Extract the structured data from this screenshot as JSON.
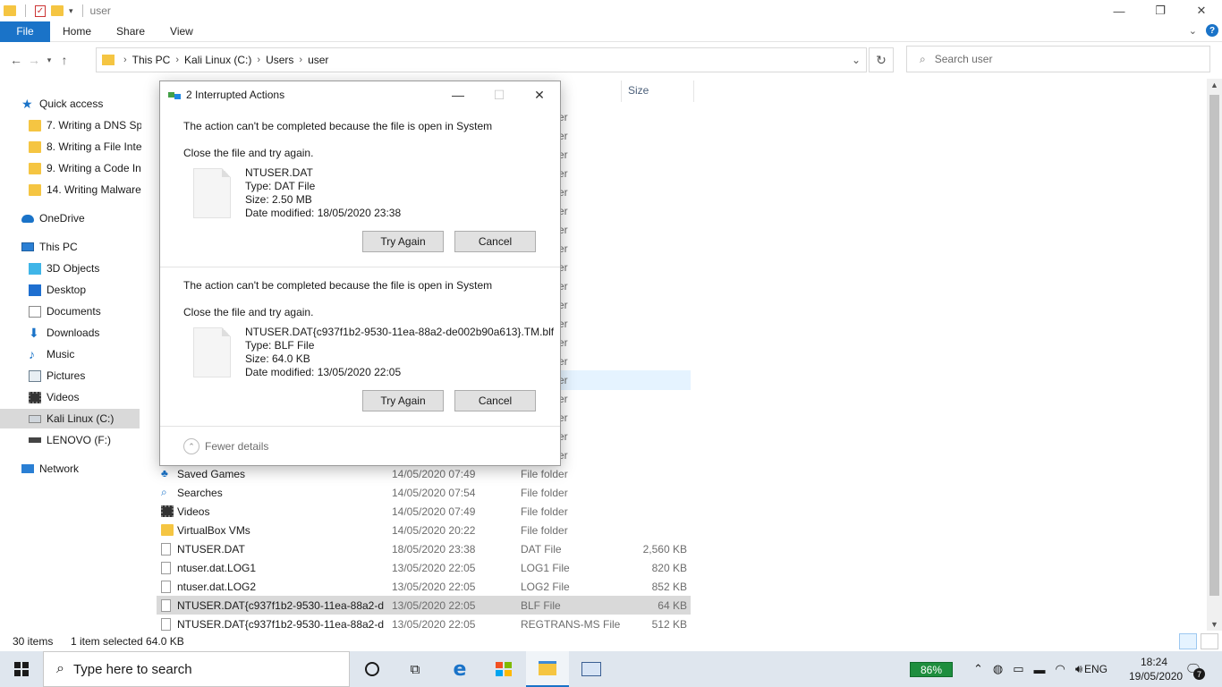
{
  "window": {
    "title": "user",
    "controls": {
      "minimize": "—",
      "maximize": "❐",
      "close": "✕"
    }
  },
  "ribbon": {
    "tabs": [
      "File",
      "Home",
      "Share",
      "View"
    ]
  },
  "address": {
    "crumbs": [
      "This PC",
      "Kali Linux (C:)",
      "Users",
      "user"
    ],
    "search_placeholder": "Search user"
  },
  "nav": {
    "quick_access": "Quick access",
    "pinned": [
      "7. Writing a DNS Sp",
      "8. Writing a File Inte",
      "9. Writing a Code In",
      "14. Writing Malware"
    ],
    "onedrive": "OneDrive",
    "this_pc": "This PC",
    "pc_items": [
      "3D Objects",
      "Desktop",
      "Documents",
      "Downloads",
      "Music",
      "Pictures",
      "Videos",
      "Kali Linux (C:)",
      "LENOVO (F:)"
    ],
    "network": "Network"
  },
  "files": {
    "size_header": "Size",
    "behind_dialog_type": "er",
    "rows": [
      {
        "name": "Saved Games",
        "date": "14/05/2020 07:49",
        "type": "File folder",
        "size": "",
        "icon": "games-icon"
      },
      {
        "name": "Searches",
        "date": "14/05/2020 07:54",
        "type": "File folder",
        "size": "",
        "icon": "searches-icon"
      },
      {
        "name": "Videos",
        "date": "14/05/2020 07:49",
        "type": "File folder",
        "size": "",
        "icon": "videos-icon"
      },
      {
        "name": "VirtualBox VMs",
        "date": "14/05/2020 20:22",
        "type": "File folder",
        "size": "",
        "icon": "folder-icon"
      },
      {
        "name": "NTUSER.DAT",
        "date": "18/05/2020 23:38",
        "type": "DAT File",
        "size": "2,560 KB",
        "icon": "file-icon"
      },
      {
        "name": "ntuser.dat.LOG1",
        "date": "13/05/2020 22:05",
        "type": "LOG1 File",
        "size": "820 KB",
        "icon": "file-icon"
      },
      {
        "name": "ntuser.dat.LOG2",
        "date": "13/05/2020 22:05",
        "type": "LOG2 File",
        "size": "852 KB",
        "icon": "file-icon"
      },
      {
        "name": "NTUSER.DAT{c937f1b2-9530-11ea-88a2-d...",
        "date": "13/05/2020 22:05",
        "type": "BLF File",
        "size": "64 KB",
        "icon": "file-icon"
      },
      {
        "name": "NTUSER.DAT{c937f1b2-9530-11ea-88a2-d...",
        "date": "13/05/2020 22:05",
        "type": "REGTRANS-MS File",
        "size": "512 KB",
        "icon": "file-icon"
      }
    ]
  },
  "status": {
    "count": "30 items",
    "selected": "1 item selected  64.0 KB"
  },
  "dialog": {
    "title": "2 Interrupted Actions",
    "actions": [
      {
        "message": "The action can't be completed because the file is open in System",
        "hint": "Close the file and try again.",
        "file_name": "NTUSER.DAT",
        "file_type": "Type: DAT File",
        "file_size": "Size: 2.50 MB",
        "file_date": "Date modified: 18/05/2020 23:38",
        "try_again": "Try Again",
        "cancel": "Cancel"
      },
      {
        "message": "The action can't be completed because the file is open in System",
        "hint": "Close the file and try again.",
        "file_name": "NTUSER.DAT{c937f1b2-9530-11ea-88a2-de002b90a613}.TM.blf",
        "file_type": "Type: BLF File",
        "file_size": "Size: 64.0 KB",
        "file_date": "Date modified: 13/05/2020 22:05",
        "try_again": "Try Again",
        "cancel": "Cancel"
      }
    ],
    "fewer_details": "Fewer details"
  },
  "taskbar": {
    "search_placeholder": "Type here to search",
    "battery": "86%",
    "language": "ENG",
    "time": "18:24",
    "date": "19/05/2020",
    "notifications": "7"
  }
}
